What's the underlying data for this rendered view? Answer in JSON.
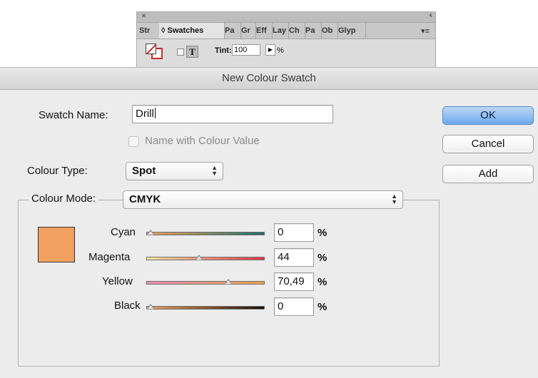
{
  "panel": {
    "close_icon": "×",
    "collapse_icon": "‹‹",
    "tabs": [
      "Str",
      "◊ Swatches",
      "Pa",
      "Gr",
      "Eff",
      "Lay",
      "Ch",
      "Pa",
      "Ob",
      "Glyp"
    ],
    "menu_icon": "▾≡",
    "tint_label": "Tint:",
    "tint_value": "100",
    "tint_arrow": "▶",
    "tint_unit": "%"
  },
  "dialog": {
    "title": "New Colour Swatch",
    "swatch_name_label": "Swatch Name:",
    "swatch_name_value": "Drill",
    "name_with_colour_value_label": "Name with Colour Value",
    "name_with_colour_value_checked": false,
    "colour_type_label": "Colour Type:",
    "colour_type_value": "Spot",
    "colour_mode_label": "Colour Mode:",
    "colour_mode_value": "CMYK",
    "buttons": {
      "ok": "OK",
      "cancel": "Cancel",
      "add": "Add"
    },
    "preview_color": "#f0a05f",
    "channels": [
      {
        "name": "Cyan",
        "value": "0",
        "level": 0,
        "unit": "%"
      },
      {
        "name": "Magenta",
        "value": "44",
        "level": 0.44,
        "unit": "%"
      },
      {
        "name": "Yellow",
        "value": "70,49",
        "level": 0.7049,
        "unit": "%"
      },
      {
        "name": "Black",
        "value": "0",
        "level": 0,
        "unit": "%"
      }
    ]
  }
}
